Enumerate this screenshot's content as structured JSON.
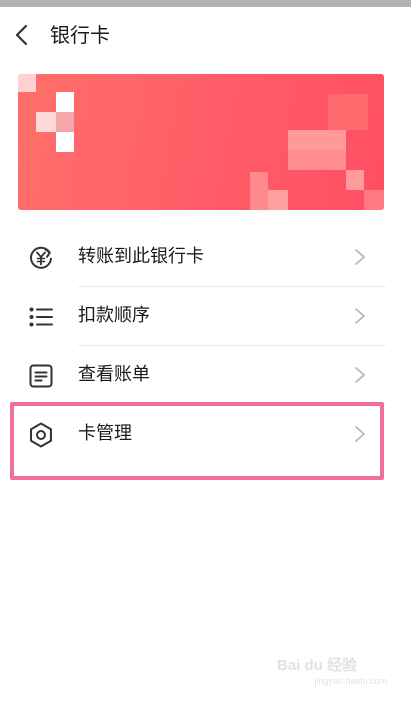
{
  "header": {
    "title": "银行卡"
  },
  "menu": {
    "items": [
      {
        "label": "转账到此银行卡",
        "icon": "yen-transfer-icon"
      },
      {
        "label": "扣款顺序",
        "icon": "list-icon"
      },
      {
        "label": "查看账单",
        "icon": "bill-icon"
      },
      {
        "label": "卡管理",
        "icon": "gear-icon"
      }
    ]
  },
  "colors": {
    "card_gradient_start": "#ff6f6b",
    "card_gradient_end": "#ff4f63",
    "highlight_border": "#f06f9e"
  },
  "watermark": {
    "main": "Bai du 经验",
    "sub": "jingyan.baidu.com"
  }
}
